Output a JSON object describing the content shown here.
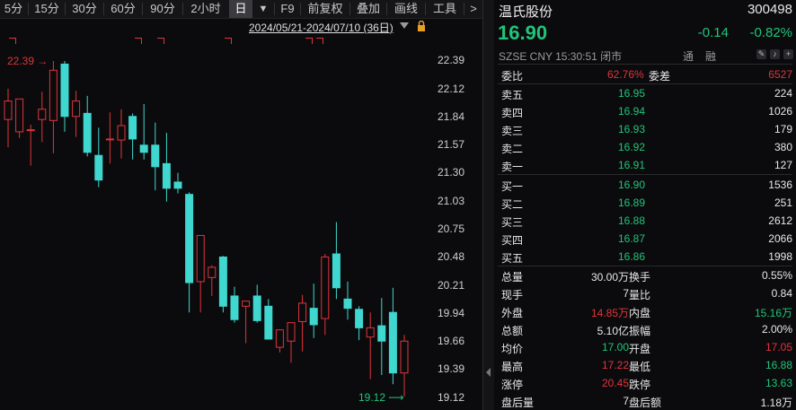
{
  "toolbar": {
    "items": [
      "5分",
      "15分",
      "30分",
      "60分",
      "90分",
      "2小时",
      "日",
      "▼",
      "F9",
      "前复权",
      "叠加",
      "画线",
      "工具",
      ">"
    ],
    "selected_index": 6
  },
  "chart": {
    "range_label": "2024/05/21-2024/07/10 (36日)",
    "y_ticks": [
      "22.39",
      "22.12",
      "21.84",
      "21.57",
      "21.30",
      "21.03",
      "20.75",
      "20.48",
      "20.21",
      "19.94",
      "19.66",
      "19.39",
      "19.12"
    ],
    "high_label": "22.39",
    "low_label": "19.12",
    "colors": {
      "up": "#e0343c",
      "down": "#3fd7cf",
      "bg": "#0b0b0d"
    }
  },
  "chart_data": {
    "type": "candlestick",
    "ylim": [
      19.12,
      22.39
    ],
    "candles": [
      {
        "o": 21.82,
        "h": 22.12,
        "l": 21.55,
        "c": 22.0
      },
      {
        "o": 21.7,
        "h": 22.02,
        "l": 21.64,
        "c": 22.02
      },
      {
        "o": 21.72,
        "h": 21.77,
        "l": 21.37,
        "c": 21.72
      },
      {
        "o": 21.82,
        "h": 22.09,
        "l": 21.6,
        "c": 21.92
      },
      {
        "o": 21.81,
        "h": 22.39,
        "l": 21.49,
        "c": 22.3
      },
      {
        "o": 22.36,
        "h": 22.39,
        "l": 21.7,
        "c": 21.85
      },
      {
        "o": 21.85,
        "h": 22.1,
        "l": 21.65,
        "c": 22.0
      },
      {
        "o": 21.88,
        "h": 22.05,
        "l": 21.46,
        "c": 21.5
      },
      {
        "o": 21.47,
        "h": 21.74,
        "l": 21.16,
        "c": 21.23
      },
      {
        "o": 21.63,
        "h": 21.89,
        "l": 21.39,
        "c": 21.63
      },
      {
        "o": 21.62,
        "h": 21.92,
        "l": 21.44,
        "c": 21.76
      },
      {
        "o": 21.85,
        "h": 21.88,
        "l": 21.43,
        "c": 21.63
      },
      {
        "o": 21.57,
        "h": 21.97,
        "l": 21.43,
        "c": 21.5
      },
      {
        "o": 21.57,
        "h": 21.79,
        "l": 21.13,
        "c": 21.36
      },
      {
        "o": 21.39,
        "h": 21.69,
        "l": 21.02,
        "c": 21.15
      },
      {
        "o": 21.21,
        "h": 21.3,
        "l": 21.1,
        "c": 21.15
      },
      {
        "o": 21.09,
        "h": 21.11,
        "l": 19.94,
        "c": 20.23
      },
      {
        "o": 20.24,
        "h": 20.56,
        "l": 19.94,
        "c": 20.69
      },
      {
        "o": 20.28,
        "h": 20.4,
        "l": 20.1,
        "c": 20.38
      },
      {
        "o": 20.48,
        "h": 20.49,
        "l": 19.94,
        "c": 20.0
      },
      {
        "o": 20.1,
        "h": 20.19,
        "l": 19.84,
        "c": 19.87
      },
      {
        "o": 20.0,
        "h": 20.03,
        "l": 19.64,
        "c": 20.05
      },
      {
        "o": 20.1,
        "h": 20.21,
        "l": 19.84,
        "c": 19.86
      },
      {
        "o": 20.0,
        "h": 20.07,
        "l": 19.68,
        "c": 19.68
      },
      {
        "o": 19.6,
        "h": 19.75,
        "l": 19.55,
        "c": 19.77
      },
      {
        "o": 19.66,
        "h": 19.78,
        "l": 19.45,
        "c": 19.84
      },
      {
        "o": 19.85,
        "h": 20.11,
        "l": 19.56,
        "c": 20.03
      },
      {
        "o": 19.98,
        "h": 20.22,
        "l": 19.69,
        "c": 19.82
      },
      {
        "o": 19.88,
        "h": 20.51,
        "l": 19.72,
        "c": 20.48
      },
      {
        "o": 20.51,
        "h": 20.82,
        "l": 20.07,
        "c": 20.18
      },
      {
        "o": 20.07,
        "h": 20.24,
        "l": 19.87,
        "c": 19.98
      },
      {
        "o": 19.97,
        "h": 20.0,
        "l": 19.67,
        "c": 19.79
      },
      {
        "o": 19.7,
        "h": 19.94,
        "l": 19.29,
        "c": 19.79
      },
      {
        "o": 19.81,
        "h": 20.08,
        "l": 19.33,
        "c": 19.66
      },
      {
        "o": 19.94,
        "h": 20.18,
        "l": 19.24,
        "c": 19.35
      },
      {
        "o": 19.35,
        "h": 19.72,
        "l": 19.12,
        "c": 19.66
      }
    ]
  },
  "quote": {
    "name": "温氏股份",
    "code": "300498",
    "price": "16.90",
    "change": "-0.14",
    "change_pct": "-0.82%",
    "exchange_info": "SZSE  CNY  15:30:51  闭市",
    "tong": "通",
    "rong": "融",
    "weibi_label": "委比",
    "weibi_value": "62.76%",
    "weicha_label": "委差",
    "weicha_value": "6527",
    "asks": [
      {
        "label": "卖五",
        "price": "16.95",
        "vol": "224"
      },
      {
        "label": "卖四",
        "price": "16.94",
        "vol": "1026"
      },
      {
        "label": "卖三",
        "price": "16.93",
        "vol": "179"
      },
      {
        "label": "卖二",
        "price": "16.92",
        "vol": "380"
      },
      {
        "label": "卖一",
        "price": "16.91",
        "vol": "127"
      }
    ],
    "bids": [
      {
        "label": "买一",
        "price": "16.90",
        "vol": "1536"
      },
      {
        "label": "买二",
        "price": "16.89",
        "vol": "251"
      },
      {
        "label": "买三",
        "price": "16.88",
        "vol": "2612"
      },
      {
        "label": "买四",
        "price": "16.87",
        "vol": "2066"
      },
      {
        "label": "买五",
        "price": "16.86",
        "vol": "1998"
      }
    ],
    "stats": [
      {
        "l1": "总量",
        "v1": "30.00万",
        "l2": "换手",
        "v2": "0.55%"
      },
      {
        "l1": "现手",
        "v1": "7",
        "l2": "量比",
        "v2": "0.84"
      },
      {
        "l1": "外盘",
        "v1": "14.85万",
        "l2": "内盘",
        "v2": "15.16万"
      },
      {
        "l1": "总额",
        "v1": "5.10亿",
        "l2": "振幅",
        "v2": "2.00%"
      },
      {
        "l1": "均价",
        "v1": "17.00",
        "l2": "开盘",
        "v2": "17.05"
      },
      {
        "l1": "最高",
        "v1": "17.22",
        "l2": "最低",
        "v2": "16.88"
      },
      {
        "l1": "涨停",
        "v1": "20.45",
        "l2": "跌停",
        "v2": "13.63"
      },
      {
        "l1": "盘后量",
        "v1": "7",
        "l2": "盘后额",
        "v2": "1.18万"
      }
    ]
  }
}
